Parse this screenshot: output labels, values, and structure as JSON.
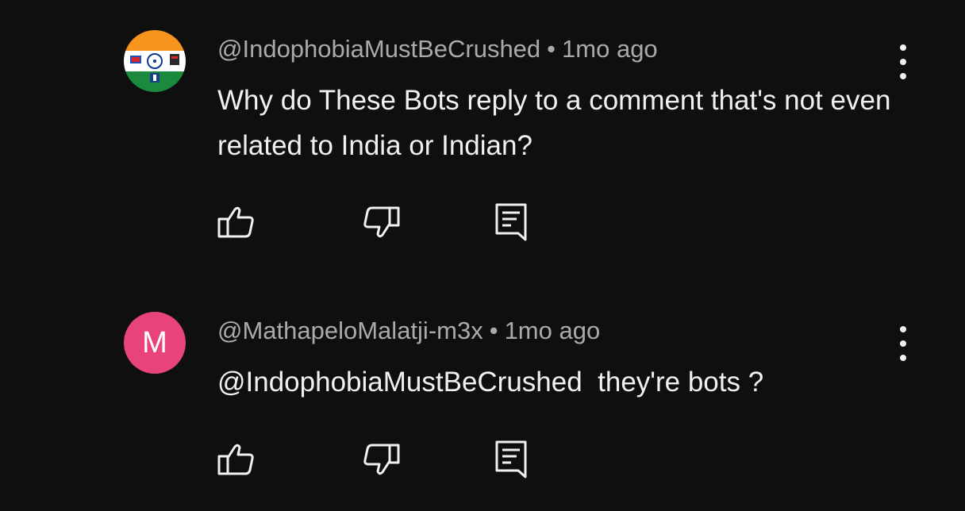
{
  "comments": [
    {
      "author": "@IndophobiaMustBeCrushed",
      "separator": "•",
      "time": "1mo ago",
      "text": "Why do These Bots reply to a comment that's not even related to India or Indian?",
      "avatar": {
        "type": "image",
        "description_icon": "flag-avatar-icon"
      }
    },
    {
      "author": "@MathapeloMalatji-m3x",
      "separator": "•",
      "time": "1mo ago",
      "text": "@IndophobiaMustBeCrushed  they're bots ?",
      "avatar": {
        "type": "letter",
        "letter": "M",
        "color": "#e8447a"
      }
    }
  ],
  "theme": {
    "background": "#0f0f0f",
    "text_primary": "#f1f1f1",
    "text_secondary": "#aaaaaa"
  },
  "icons": {
    "like": "thumbs-up-icon",
    "dislike": "thumbs-down-icon",
    "reply": "comment-reply-icon",
    "more": "more-vertical-icon"
  }
}
